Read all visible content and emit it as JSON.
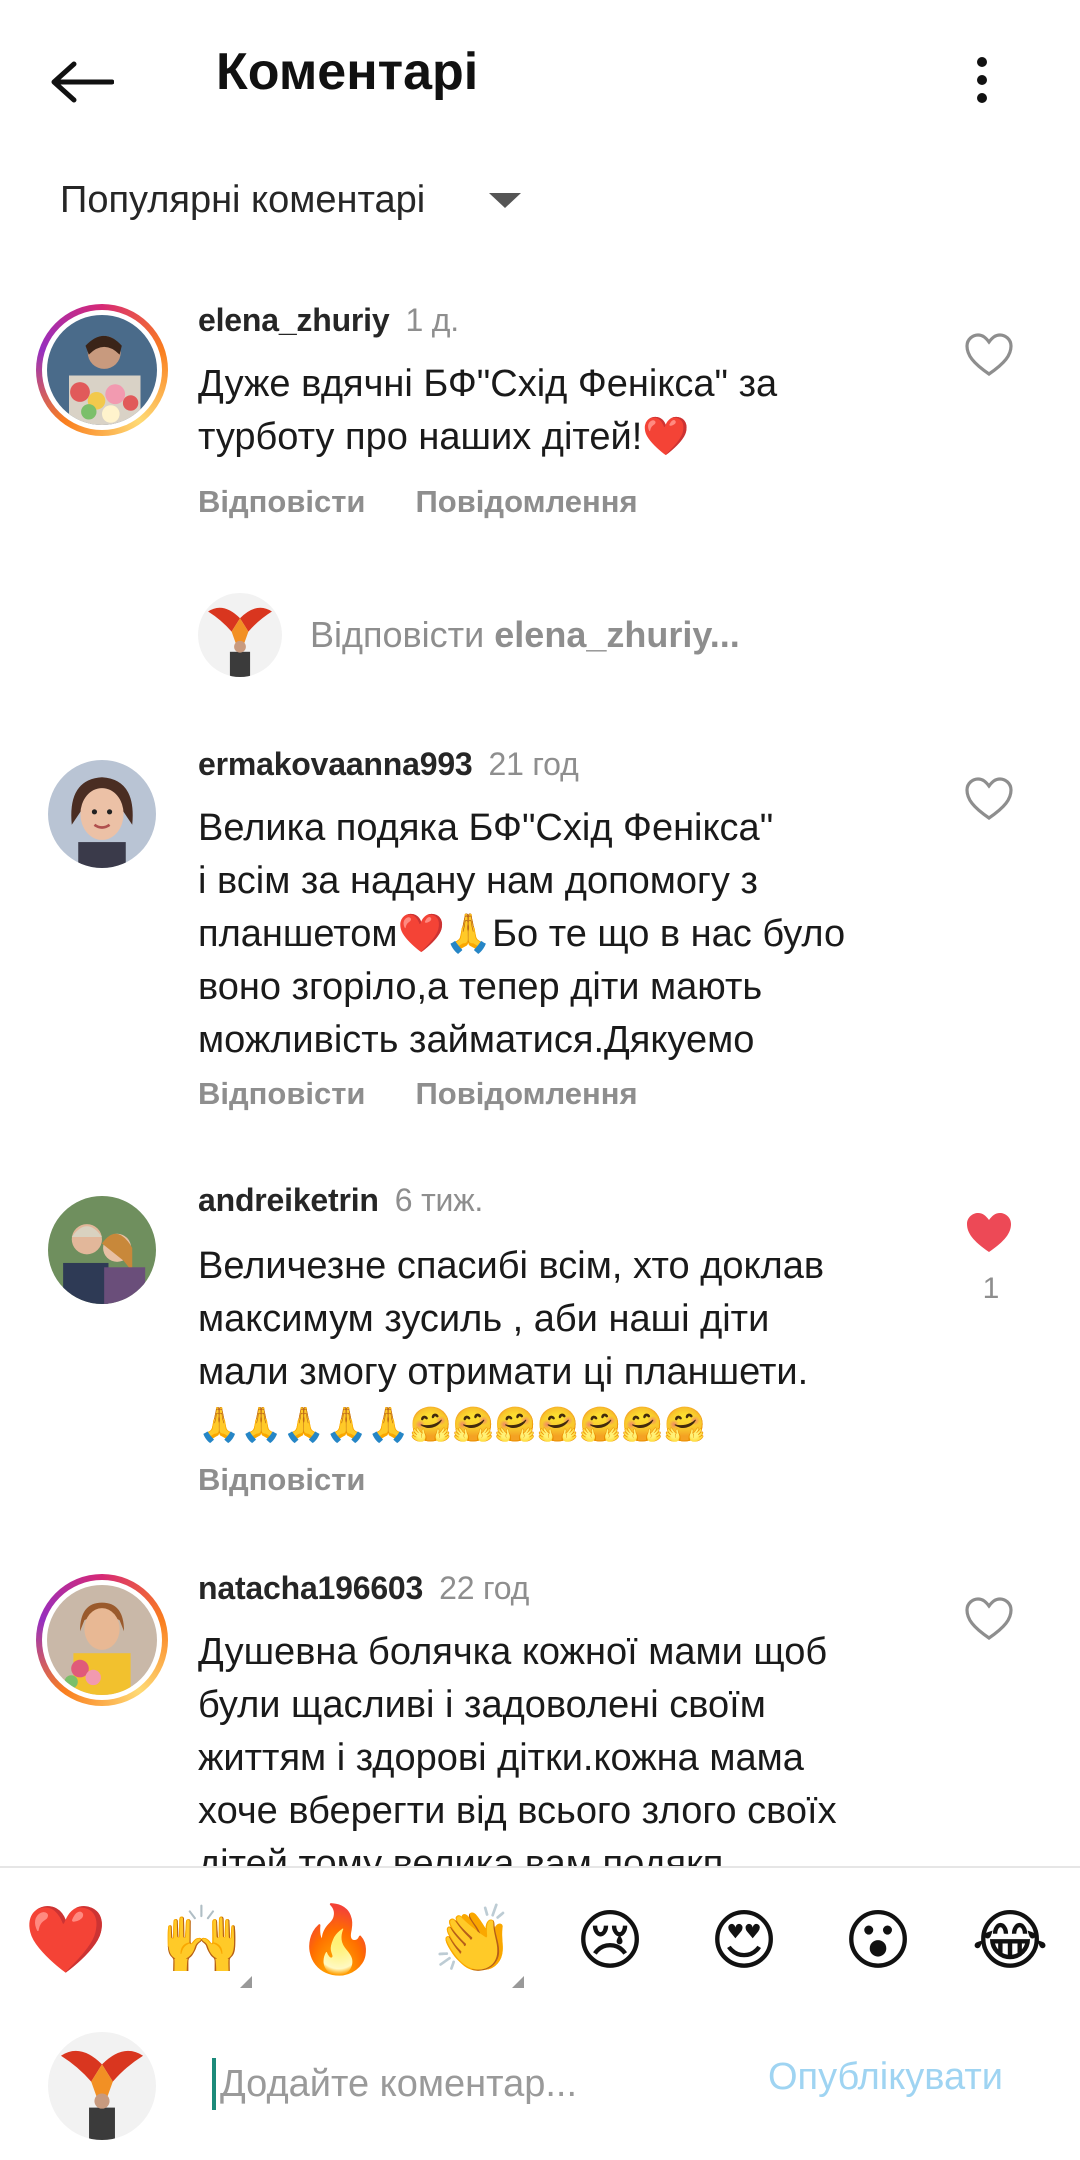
{
  "header": {
    "title": "Коментарі"
  },
  "sort": {
    "label": "Популярні коментарі"
  },
  "comments": [
    {
      "username": "elena_zhuriy",
      "time": "1 д.",
      "text_lines": [
        "Дуже вдячні БФ\"Схід Фенікса\" за",
        "турботу про наших дітей!❤️"
      ],
      "reply_label": "Відповісти",
      "message_label": "Повідомлення",
      "liked": false
    },
    {
      "username": "ermakovaanna993",
      "time": "21 год",
      "text_lines": [
        "Велика подяка БФ\"Схід Фенікса\"",
        "і всім за надану нам допомогу з",
        "планшетом❤️🙏Бо те що в нас було",
        "воно згоріло,а тепер діти мають",
        "можливість займатися.Дякуемо"
      ],
      "reply_label": "Відповісти",
      "message_label": "Повідомлення",
      "liked": false
    },
    {
      "username": "andreiketrin",
      "time": "6 тиж.",
      "text_lines": [
        "Величезне спасибі всім, хто доклав",
        "максимум зусиль , аби наші діти",
        "мали змогу отримати ці планшети.",
        "🙏🙏🙏🙏🙏🤗🤗🤗🤗🤗🤗🤗"
      ],
      "reply_label": "Відповісти",
      "liked": true,
      "like_count": "1"
    },
    {
      "username": "natacha196603",
      "time": "22 год",
      "text_lines": [
        "Душевна болячка кожної мами щоб",
        "були щасливі і задоволені своїм",
        "життям і здорові дітки.кожна мама",
        "хоче вберегти від всього злого своїх",
        "дітей тому велика вам подякп"
      ],
      "liked": false
    }
  ],
  "reply_prompt": {
    "prefix": "Відповісти",
    "target": "elena_zhuriy..."
  },
  "emoji_bar": [
    "❤️",
    "🙌",
    "🔥",
    "👏",
    "😢",
    "😍",
    "😮",
    "😂"
  ],
  "composer": {
    "placeholder": "Додайте коментар...",
    "publish_label": "Опублікувати"
  },
  "colors": {
    "like_red": "#ed4956",
    "publish_disabled": "#9fd4f2",
    "muted": "#8e8e8e"
  }
}
